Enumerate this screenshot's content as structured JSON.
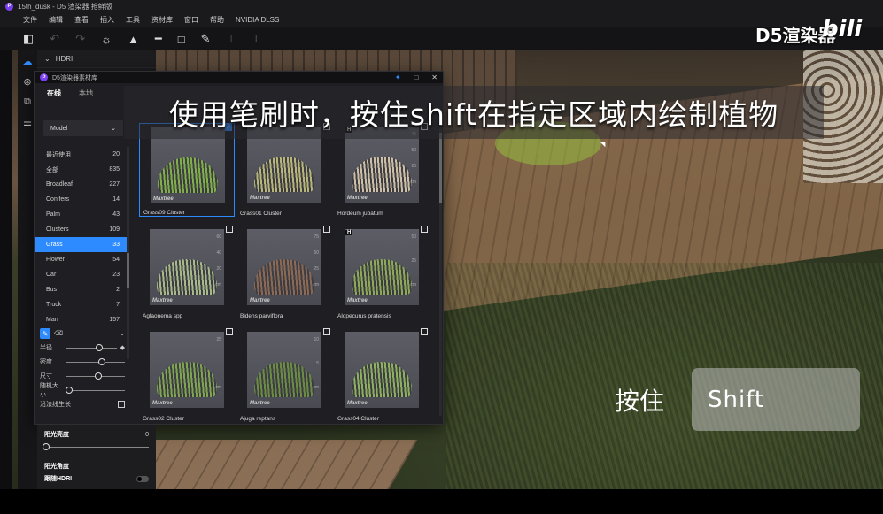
{
  "window": {
    "title": "15th_dusk - D5 渲染器 抢鲜版"
  },
  "menu": [
    "文件",
    "编辑",
    "查看",
    "插入",
    "工具",
    "资材库",
    "窗口",
    "帮助",
    "NVIDIA DLSS"
  ],
  "side_panel": {
    "section": "HDRI"
  },
  "library": {
    "title": "D5渲染器素材库",
    "tabs": [
      {
        "label": "在线",
        "active": true
      },
      {
        "label": "本地",
        "active": false
      }
    ],
    "filter": "Model",
    "categories": [
      {
        "name": "最近使用",
        "count": "20"
      },
      {
        "name": "全部",
        "count": "835"
      },
      {
        "name": "Broadleaf",
        "count": "227"
      },
      {
        "name": "Conifers",
        "count": "14"
      },
      {
        "name": "Palm",
        "count": "43"
      },
      {
        "name": "Clusters",
        "count": "109"
      },
      {
        "name": "Grass",
        "count": "33",
        "selected": true
      },
      {
        "name": "Flower",
        "count": "54"
      },
      {
        "name": "Car",
        "count": "23"
      },
      {
        "name": "Bus",
        "count": "2"
      },
      {
        "name": "Truck",
        "count": "7"
      },
      {
        "name": "Man",
        "count": "157"
      }
    ],
    "brush": {
      "rows": [
        {
          "label": "半径",
          "level": 0.65
        },
        {
          "label": "密度",
          "level": 0.6
        },
        {
          "label": "尺寸",
          "level": 0.55
        },
        {
          "label": "随机大小",
          "level": 0.05
        }
      ],
      "normal_growth_label": "沿法线生长"
    },
    "assets": [
      {
        "name": "Grass09 Cluster",
        "brand": "Maxtree",
        "selected": true,
        "plant": "#7fae4a",
        "ruler": []
      },
      {
        "name": "Grass01 Cluster",
        "brand": "Maxtree",
        "selected": false,
        "plant": "#b7b57a",
        "ruler": []
      },
      {
        "name": "Hordeum jubatum",
        "brand": "Maxtree",
        "selected": false,
        "plant": "#cdbfa5",
        "badge": "H",
        "ruler": [
          "75",
          "50",
          "25",
          "cm"
        ]
      },
      {
        "name": "Aglaonema spp",
        "brand": "Maxtree",
        "selected": false,
        "plant": "#a7b98a",
        "ruler": [
          "60",
          "40",
          "20",
          "cm"
        ]
      },
      {
        "name": "Bidens parviflora",
        "brand": "Maxtree",
        "selected": false,
        "plant": "#8a6a55",
        "ruler": [
          "75",
          "50",
          "25",
          "cm"
        ]
      },
      {
        "name": "Alopecurus pratensis",
        "brand": "Maxtree",
        "selected": false,
        "plant": "#8ca858",
        "badge": "H",
        "ruler": [
          "50",
          "25",
          "cm"
        ]
      },
      {
        "name": "Grass02 Cluster",
        "brand": "Maxtree",
        "selected": false,
        "plant": "#7fa553",
        "ruler": [
          "25",
          "cm"
        ]
      },
      {
        "name": "Ajuga reptans",
        "brand": "Maxtree",
        "selected": false,
        "plant": "#6b8c45",
        "ruler": [
          "10",
          "5",
          "cm"
        ]
      },
      {
        "name": "Grass04 Cluster",
        "brand": "Maxtree",
        "selected": false,
        "plant": "#8db060",
        "ruler": []
      }
    ]
  },
  "sun": {
    "brightness_label": "阳光亮度",
    "brightness_value": "0",
    "angle_label": "阳光角度",
    "follow_hdri_label": "跟随HDRI"
  },
  "caption": "使用笔刷时，按住shift在指定区域内绘制植物",
  "hold_label": "按住",
  "key": "Shift",
  "watermark": {
    "d5": "D5渲染器",
    "bili": "bili"
  }
}
